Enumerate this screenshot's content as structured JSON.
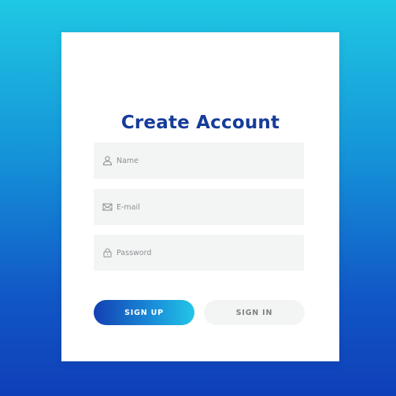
{
  "form": {
    "title": "Create Account",
    "fields": [
      {
        "icon": "user-icon",
        "placeholder": "Name"
      },
      {
        "icon": "envelope-icon",
        "placeholder": "E-mail"
      },
      {
        "icon": "lock-icon",
        "placeholder": "Password"
      }
    ],
    "buttons": {
      "sign_up": "SIGN UP",
      "sign_in": "SIGN IN"
    }
  },
  "colors": {
    "title": "#163c9a",
    "field_background": "#f3f5f5",
    "primary_gradient_start": "#1240b3",
    "primary_gradient_end": "#22c6e6",
    "background_top": "#1fc8e3",
    "background_bottom": "#0f3fb8"
  }
}
